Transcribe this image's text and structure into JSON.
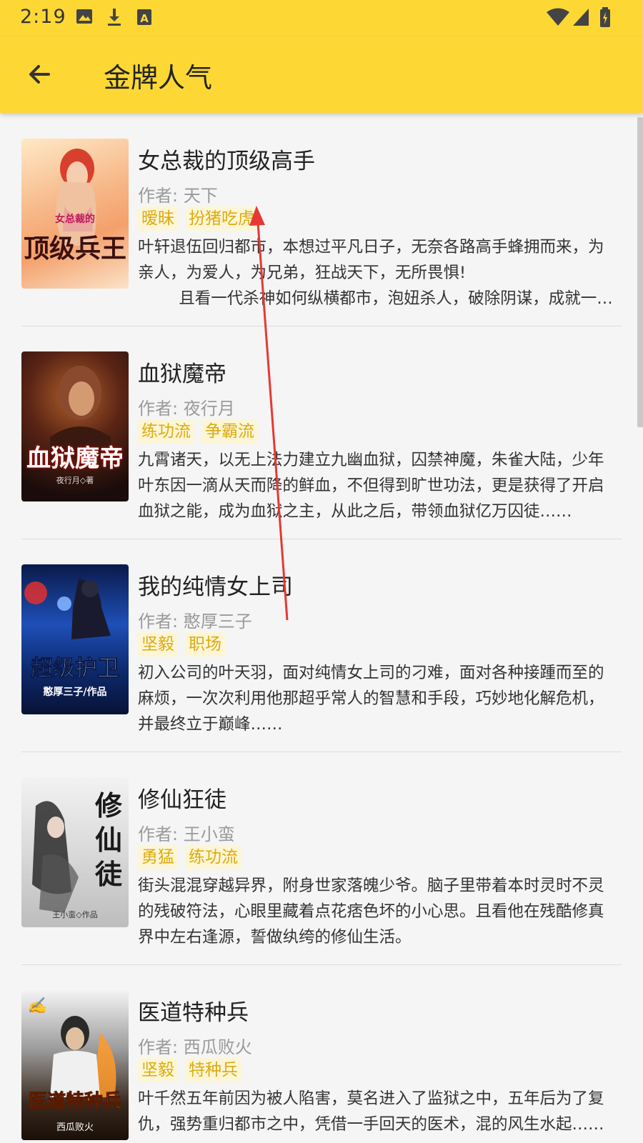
{
  "status_bar": {
    "time": "2:19",
    "icons": [
      "image-icon",
      "download-icon",
      "font-a-icon",
      "wifi-icon",
      "signal-icon",
      "battery-icon"
    ]
  },
  "app_bar": {
    "back_icon": "arrow-left-icon",
    "title": "金牌人气"
  },
  "colors": {
    "accent": "#fdd835",
    "tag_text": "#dcaa10",
    "tag_bg": "#fdf6d6",
    "annotation_arrow": "#e53935"
  },
  "books": [
    {
      "title": "女总裁的顶级高手",
      "author": "作者: 天下",
      "tags": [
        "暧昧",
        "扮猪吃虎"
      ],
      "description": "叶轩退伍回归都市，本想过平凡日子，无奈各路高手蜂拥而来，为亲人，为爱人，为兄弟，狂战天下，无所畏惧!\n        且看一代杀神如何纵横都市，泡妞杀人，破除阴谋，成就一代传奇……",
      "cover_text": "顶级兵王",
      "cover_sub": "女总裁的"
    },
    {
      "title": "血狱魔帝",
      "author": "作者: 夜行月",
      "tags": [
        "练功流",
        "争霸流"
      ],
      "description": "九霄诸天，以无上法力建立九幽血狱，囚禁神魔，朱雀大陆，少年叶东因一滴从天而降的鲜血，不但得到旷世功法，更是获得了开启血狱之能，成为血狱之主，从此之后，带领血狱亿万囚徒……",
      "cover_text": "血狱魔帝",
      "cover_sub": "夜行月◇著"
    },
    {
      "title": "我的纯情女上司",
      "author": "作者: 憨厚三子",
      "tags": [
        "坚毅",
        "职场"
      ],
      "description": "初入公司的叶天羽，面对纯情女上司的刁难，面对各种接踵而至的麻烦，一次次利用他那超乎常人的智慧和手段，巧妙地化解危机，并最终立于巅峰……",
      "cover_text": "超级护卫",
      "cover_sub": "憨厚三子/作品"
    },
    {
      "title": "修仙狂徒",
      "author": "作者: 王小蛮",
      "tags": [
        "勇猛",
        "练功流"
      ],
      "description": "街头混混穿越异界，附身世家落魄少爷。脑子里带着本时灵时不灵的残破符法，心眼里藏着点花痞色坏的小心思。且看他在残酷修真界中左右逢源，誓做纨绔的修仙生活。",
      "cover_text": "修仙徒",
      "cover_sub": "王小蛮◇作品"
    },
    {
      "title": "医道特种兵",
      "author": "作者: 西瓜败火",
      "tags": [
        "坚毅",
        "特种兵"
      ],
      "description": "叶千然五年前因为被人陷害，莫名进入了监狱之中，五年后为了复仇，强势重归都市之中，凭借一手回天的医术，混的风生水起……",
      "cover_text": "医道特种兵",
      "cover_sub": "西瓜败火"
    }
  ]
}
